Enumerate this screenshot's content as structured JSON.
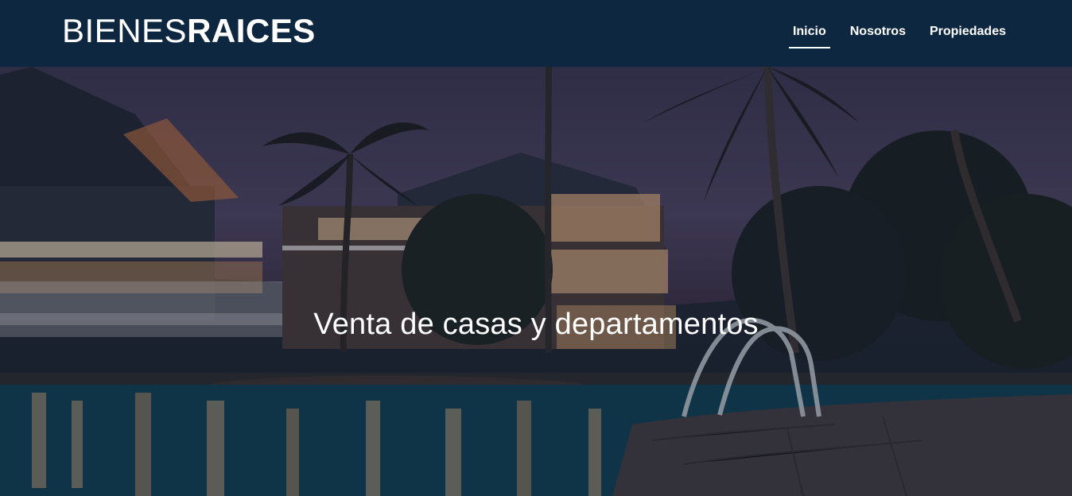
{
  "header": {
    "logo_light": "BIENES",
    "logo_bold": "RAICES",
    "nav": [
      {
        "label": "Inicio",
        "active": true
      },
      {
        "label": "Nosotros",
        "active": false
      },
      {
        "label": "Propiedades",
        "active": false
      }
    ]
  },
  "hero": {
    "title": "Venta de casas y departamentos"
  },
  "colors": {
    "header_bg": "#0e2740",
    "text": "#ffffff"
  }
}
